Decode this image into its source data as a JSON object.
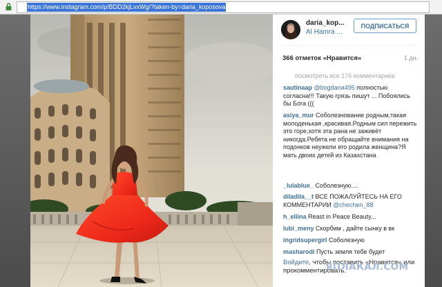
{
  "browser": {
    "url": "https://www.instagram.com/p/BDD2kjLvxWg/?taken-by=daria_koposova"
  },
  "post": {
    "username": "daria_kop...",
    "location": "Al Hamra ...",
    "follow_label": "ПОДПИСАТЬСЯ",
    "likes": "366 отметок «Нравится»",
    "time": "1 дн.",
    "view_all": "посмотреть все 176 комментариев"
  },
  "comments": [
    {
      "user": "sautinaap",
      "mention": "@bogdana495",
      "text": " полностью согласна!!! Такую грязь пишут ... Побоялись бы Бога (((",
      "end": ""
    },
    {
      "user": "asiya_mur",
      "mention": "",
      "text": " Соболезнование родным,такая молоденькая ,красивая.Родным сил пережить это горе,хотя эта рана не заживёт никогда.Ребята не обращайте внимания на подонков неужели его родила женщина?Я мать двоих детей из Казахстана",
      "end": ""
    },
    {
      "user": "_lulablue_",
      "mention": "",
      "text": " Соболезную....",
      "end": ""
    },
    {
      "user": "diladila__t",
      "mention": "",
      "text": " ВСЕ ПОЖАЛУЙТЕСЬ НА ЕГО КОММЕНТАРИИ ",
      "end": "@chechen_88"
    },
    {
      "user": "h_ellina",
      "mention": "",
      "text": " Reast in Peace Beauty...",
      "end": ""
    },
    {
      "user": "lubi_meny",
      "mention": "",
      "text": " Скорбим , дайте сынку в вк",
      "end": ""
    },
    {
      "user": "ingridsupergirl",
      "mention": "",
      "text": " Соболезную",
      "end": ""
    },
    {
      "user": "masharodi",
      "mention": "",
      "text": " Пусть земля тебе будет",
      "end": ""
    }
  ],
  "login_prompt": {
    "link": "Войдите",
    "text": ", чтобы поставить «Нравится» или прокомментировать."
  },
  "watermark": "ЯПЛАКАЛ.COM",
  "colors": {
    "link_blue": "#3f729b",
    "dress_red": "#ee2a1b",
    "url_highlight": "#3b74d8"
  },
  "icons": [
    "lock-icon",
    "avatar"
  ]
}
